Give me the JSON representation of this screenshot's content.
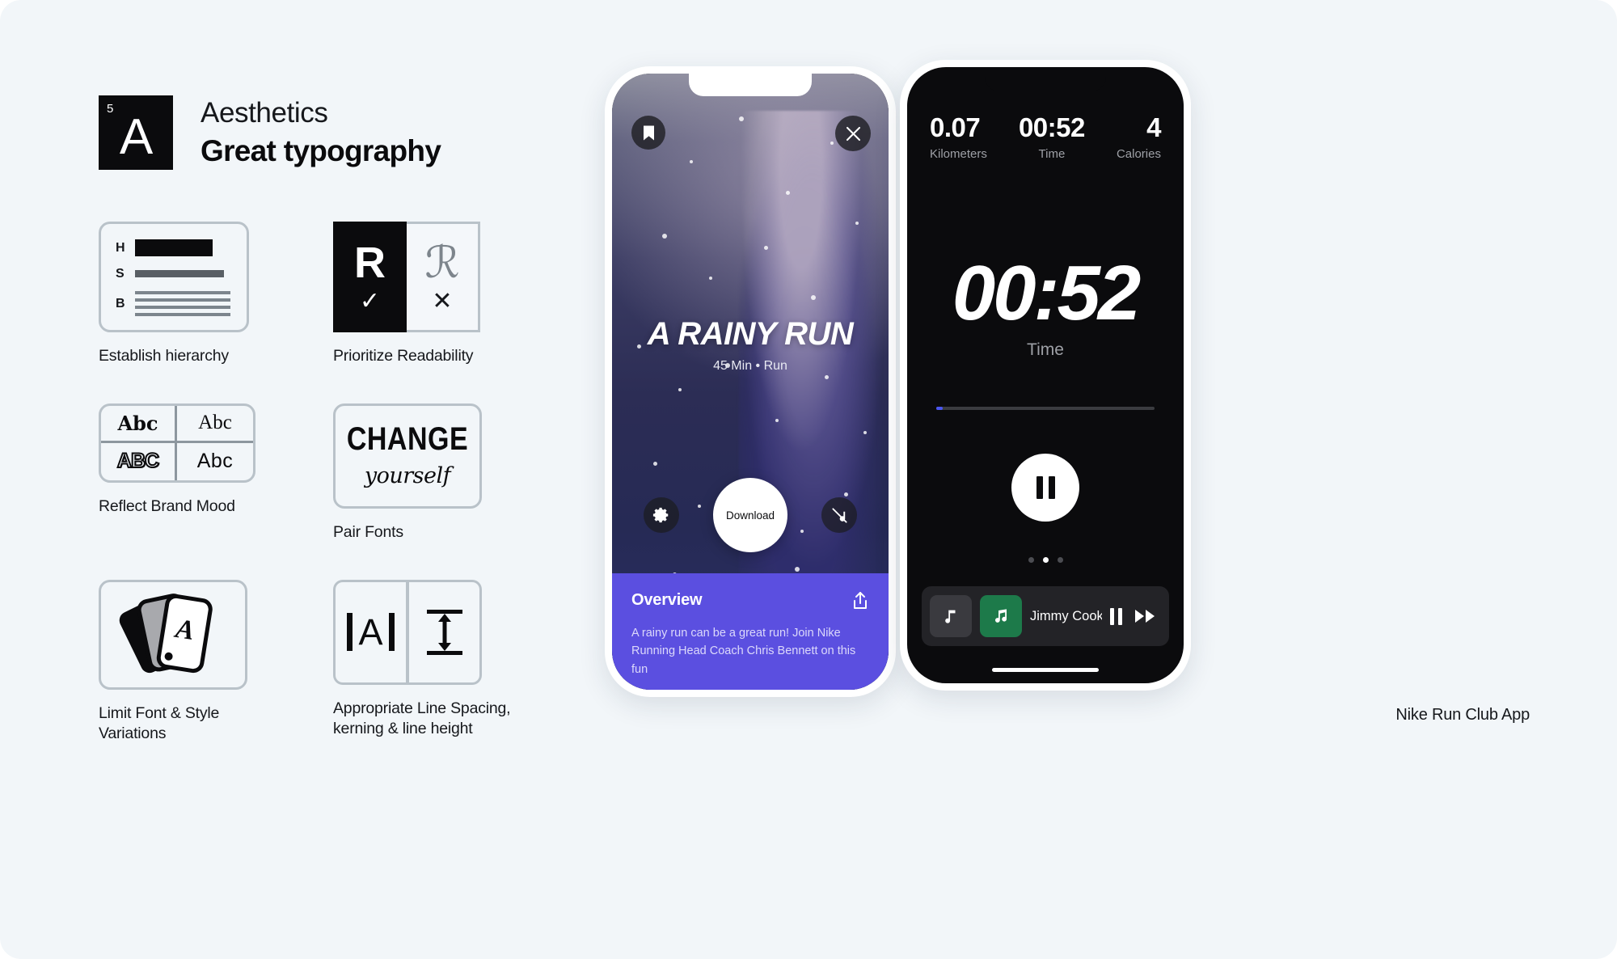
{
  "header": {
    "badge_number": "5",
    "badge_letter": "A",
    "kicker": "Aesthetics",
    "title": "Great typography"
  },
  "principles": [
    {
      "id": "establish-hierarchy",
      "caption": "Establish hierarchy",
      "rows": [
        {
          "label": "H"
        },
        {
          "label": "S"
        },
        {
          "label": "B"
        }
      ]
    },
    {
      "id": "prioritize-readability",
      "caption": "Prioritize Readability",
      "good_glyph": "R",
      "good_mark": "✓",
      "bad_glyph": "ℛ",
      "bad_mark": "✕"
    },
    {
      "id": "reflect-brand-mood",
      "caption": "Reflect Brand Mood",
      "samples": [
        "Abc",
        "Abc",
        "ABC",
        "Abc"
      ]
    },
    {
      "id": "pair-fonts",
      "caption": "Pair Fonts",
      "line_one": "CHANGE",
      "line_two": "yourself"
    },
    {
      "id": "limit-font-style-variations",
      "caption": "Limit Font & Style\nVariations",
      "card_letter": "A"
    },
    {
      "id": "line-spacing",
      "caption": "Appropriate Line Spacing,\nkerning & line height",
      "kern_letter": "A"
    }
  ],
  "phone_workout": {
    "bookmark_icon": "bookmark-icon",
    "close_icon": "close-icon",
    "hero_title": "A RAINY RUN",
    "hero_subtitle": "45 Min • Run",
    "settings_icon": "gear-icon",
    "download_label": "Download",
    "music_off_icon": "music-note-slash-icon",
    "overview_title": "Overview",
    "share_icon": "share-icon",
    "overview_body": "A rainy run can be a great run! Join Nike Running Head Coach Chris Bennett on this fun"
  },
  "phone_tracker": {
    "stats": [
      {
        "value": "0.07",
        "label": "Kilometers"
      },
      {
        "value": "00:52",
        "label": "Time"
      },
      {
        "value": "4",
        "label": "Calories"
      }
    ],
    "timer_value": "00:52",
    "timer_label": "Time",
    "progress_percent": 3,
    "pause_icon": "pause-icon",
    "page_dots": 3,
    "active_dot_index": 1,
    "music": {
      "queue_icon": "music-note-icon",
      "art_icon": "spotify-album-icon",
      "track_title": "Jimmy Cooks (f",
      "pause_icon": "pause-icon",
      "next_icon": "fast-forward-icon"
    }
  },
  "caption": {
    "app_name": "Nike Run Club App"
  },
  "colors": {
    "background": "#f2f6f9",
    "ink": "#0b0b0d",
    "accent_purple": "#5b4fe0",
    "progress_blue": "#4a56f0",
    "muted": "#9ea0a6"
  }
}
